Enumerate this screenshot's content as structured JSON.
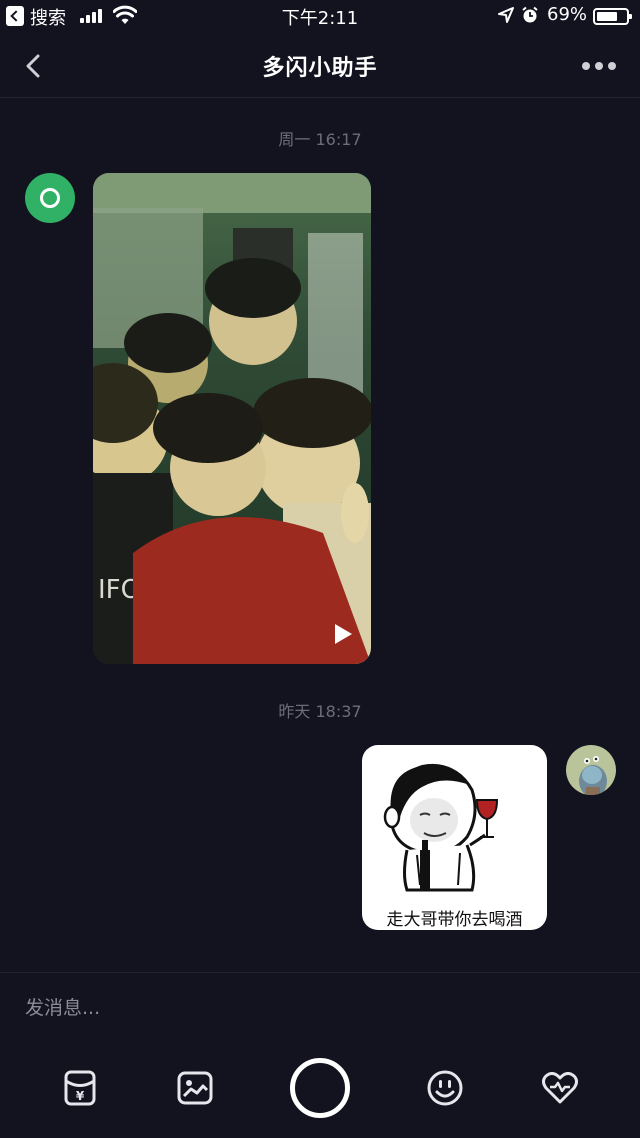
{
  "status_bar": {
    "back_app_label": "搜索",
    "time": "下午2:11",
    "battery_percent": "69%",
    "battery_level": 0.69
  },
  "nav": {
    "title": "多闪小助手"
  },
  "messages": {
    "timestamp_1": "周一 16:17",
    "timestamp_2": "昨天 18:37",
    "sticker_caption": "走大哥带你去喝酒"
  },
  "composer": {
    "placeholder": "发消息..."
  },
  "colors": {
    "background": "#13121f",
    "bot_avatar": "#31b166"
  },
  "icons": {
    "red_packet": "red-packet-icon",
    "image": "image-icon",
    "shutter": "camera-shutter-icon",
    "emoji": "emoji-icon",
    "heart": "heart-icon"
  }
}
